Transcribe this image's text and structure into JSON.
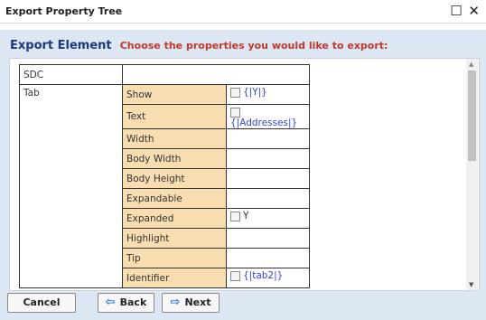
{
  "window": {
    "title": "Export Property Tree",
    "controls": {
      "restore": "☐",
      "close": "✕"
    }
  },
  "header": {
    "title": "Export Element",
    "subtitle": "Choose the properties you would like to export:"
  },
  "tree": {
    "sdc_label": "SDC",
    "tab_label": "Tab",
    "properties": [
      {
        "name": "Show",
        "checkbox": true,
        "value": "{|Y|}",
        "value_style": "link"
      },
      {
        "name": "Text",
        "checkbox": true,
        "value": "{|Addresses|}",
        "value_style": "link"
      },
      {
        "name": "Width",
        "checkbox": false,
        "value": "",
        "value_style": "plain"
      },
      {
        "name": "Body Width",
        "checkbox": false,
        "value": "",
        "value_style": "plain"
      },
      {
        "name": "Body Height",
        "checkbox": false,
        "value": "",
        "value_style": "plain"
      },
      {
        "name": "Expandable",
        "checkbox": false,
        "value": "",
        "value_style": "plain"
      },
      {
        "name": "Expanded",
        "checkbox": true,
        "value": "Y",
        "value_style": "plain"
      },
      {
        "name": "Highlight",
        "checkbox": false,
        "value": "",
        "value_style": "plain"
      },
      {
        "name": "Tip",
        "checkbox": false,
        "value": "",
        "value_style": "plain"
      },
      {
        "name": "Identifier",
        "checkbox": true,
        "value": "{|tab2|}",
        "value_style": "link"
      }
    ]
  },
  "footer": {
    "cancel_label": "Cancel",
    "back_label": "Back",
    "next_label": "Next",
    "back_icon": "left-arrow-icon",
    "next_icon": "right-arrow-icon"
  },
  "colors": {
    "header_title": "#1c3a7a",
    "header_subtitle": "#c0392b",
    "property_cell": "#f8ddb0",
    "panel_bg": "#dde6f3",
    "link_value": "#3344dd"
  }
}
